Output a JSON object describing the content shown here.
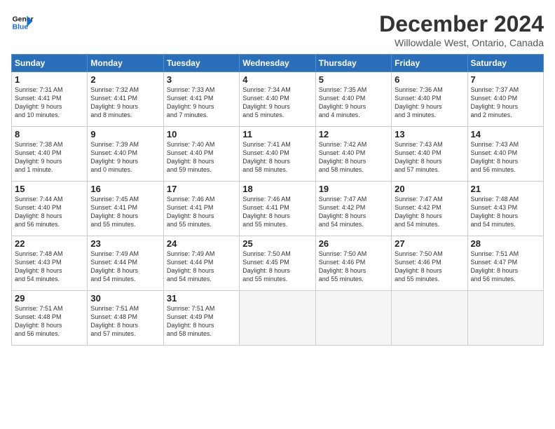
{
  "header": {
    "logo_line1": "General",
    "logo_line2": "Blue",
    "main_title": "December 2024",
    "subtitle": "Willowdale West, Ontario, Canada"
  },
  "days_of_week": [
    "Sunday",
    "Monday",
    "Tuesday",
    "Wednesday",
    "Thursday",
    "Friday",
    "Saturday"
  ],
  "weeks": [
    [
      {
        "day": "1",
        "info": "Sunrise: 7:31 AM\nSunset: 4:41 PM\nDaylight: 9 hours\nand 10 minutes."
      },
      {
        "day": "2",
        "info": "Sunrise: 7:32 AM\nSunset: 4:41 PM\nDaylight: 9 hours\nand 8 minutes."
      },
      {
        "day": "3",
        "info": "Sunrise: 7:33 AM\nSunset: 4:41 PM\nDaylight: 9 hours\nand 7 minutes."
      },
      {
        "day": "4",
        "info": "Sunrise: 7:34 AM\nSunset: 4:40 PM\nDaylight: 9 hours\nand 5 minutes."
      },
      {
        "day": "5",
        "info": "Sunrise: 7:35 AM\nSunset: 4:40 PM\nDaylight: 9 hours\nand 4 minutes."
      },
      {
        "day": "6",
        "info": "Sunrise: 7:36 AM\nSunset: 4:40 PM\nDaylight: 9 hours\nand 3 minutes."
      },
      {
        "day": "7",
        "info": "Sunrise: 7:37 AM\nSunset: 4:40 PM\nDaylight: 9 hours\nand 2 minutes."
      }
    ],
    [
      {
        "day": "8",
        "info": "Sunrise: 7:38 AM\nSunset: 4:40 PM\nDaylight: 9 hours\nand 1 minute."
      },
      {
        "day": "9",
        "info": "Sunrise: 7:39 AM\nSunset: 4:40 PM\nDaylight: 9 hours\nand 0 minutes."
      },
      {
        "day": "10",
        "info": "Sunrise: 7:40 AM\nSunset: 4:40 PM\nDaylight: 8 hours\nand 59 minutes."
      },
      {
        "day": "11",
        "info": "Sunrise: 7:41 AM\nSunset: 4:40 PM\nDaylight: 8 hours\nand 58 minutes."
      },
      {
        "day": "12",
        "info": "Sunrise: 7:42 AM\nSunset: 4:40 PM\nDaylight: 8 hours\nand 58 minutes."
      },
      {
        "day": "13",
        "info": "Sunrise: 7:43 AM\nSunset: 4:40 PM\nDaylight: 8 hours\nand 57 minutes."
      },
      {
        "day": "14",
        "info": "Sunrise: 7:43 AM\nSunset: 4:40 PM\nDaylight: 8 hours\nand 56 minutes."
      }
    ],
    [
      {
        "day": "15",
        "info": "Sunrise: 7:44 AM\nSunset: 4:40 PM\nDaylight: 8 hours\nand 56 minutes."
      },
      {
        "day": "16",
        "info": "Sunrise: 7:45 AM\nSunset: 4:41 PM\nDaylight: 8 hours\nand 55 minutes."
      },
      {
        "day": "17",
        "info": "Sunrise: 7:46 AM\nSunset: 4:41 PM\nDaylight: 8 hours\nand 55 minutes."
      },
      {
        "day": "18",
        "info": "Sunrise: 7:46 AM\nSunset: 4:41 PM\nDaylight: 8 hours\nand 55 minutes."
      },
      {
        "day": "19",
        "info": "Sunrise: 7:47 AM\nSunset: 4:42 PM\nDaylight: 8 hours\nand 54 minutes."
      },
      {
        "day": "20",
        "info": "Sunrise: 7:47 AM\nSunset: 4:42 PM\nDaylight: 8 hours\nand 54 minutes."
      },
      {
        "day": "21",
        "info": "Sunrise: 7:48 AM\nSunset: 4:43 PM\nDaylight: 8 hours\nand 54 minutes."
      }
    ],
    [
      {
        "day": "22",
        "info": "Sunrise: 7:48 AM\nSunset: 4:43 PM\nDaylight: 8 hours\nand 54 minutes."
      },
      {
        "day": "23",
        "info": "Sunrise: 7:49 AM\nSunset: 4:44 PM\nDaylight: 8 hours\nand 54 minutes."
      },
      {
        "day": "24",
        "info": "Sunrise: 7:49 AM\nSunset: 4:44 PM\nDaylight: 8 hours\nand 54 minutes."
      },
      {
        "day": "25",
        "info": "Sunrise: 7:50 AM\nSunset: 4:45 PM\nDaylight: 8 hours\nand 55 minutes."
      },
      {
        "day": "26",
        "info": "Sunrise: 7:50 AM\nSunset: 4:46 PM\nDaylight: 8 hours\nand 55 minutes."
      },
      {
        "day": "27",
        "info": "Sunrise: 7:50 AM\nSunset: 4:46 PM\nDaylight: 8 hours\nand 55 minutes."
      },
      {
        "day": "28",
        "info": "Sunrise: 7:51 AM\nSunset: 4:47 PM\nDaylight: 8 hours\nand 56 minutes."
      }
    ],
    [
      {
        "day": "29",
        "info": "Sunrise: 7:51 AM\nSunset: 4:48 PM\nDaylight: 8 hours\nand 56 minutes."
      },
      {
        "day": "30",
        "info": "Sunrise: 7:51 AM\nSunset: 4:48 PM\nDaylight: 8 hours\nand 57 minutes."
      },
      {
        "day": "31",
        "info": "Sunrise: 7:51 AM\nSunset: 4:49 PM\nDaylight: 8 hours\nand 58 minutes."
      },
      {
        "day": "",
        "info": ""
      },
      {
        "day": "",
        "info": ""
      },
      {
        "day": "",
        "info": ""
      },
      {
        "day": "",
        "info": ""
      }
    ]
  ]
}
